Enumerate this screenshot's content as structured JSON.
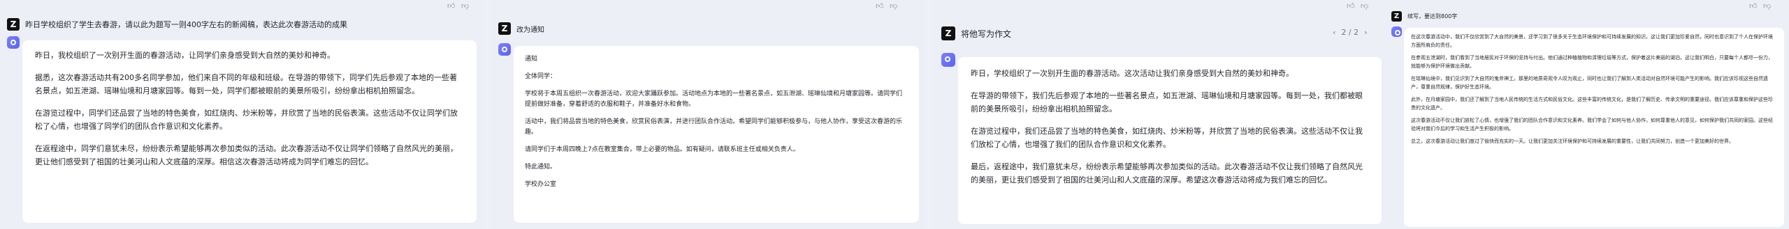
{
  "panels": [
    {
      "question": "昨日学校组织了学生去春游，请以此为题写一则400字左右的新闻稿，表达此次春游活动的成果",
      "paragraphs": [
        "昨日，我校组织了一次别开生面的春游活动，让同学们亲身感受到大自然的美妙和神奇。",
        "据悉，这次春游活动共有200多名同学参加，他们来自不同的年级和班级。在导游的带领下，同学们先后参观了本地的一些著名景点，如五泄湖、瑶琳仙境和月塘家园等。每到一处，同学们都被眼前的美景所吸引，纷纷拿出相机拍照留念。",
        "在游览过程中，同学们还品尝了当地的特色美食，如红烧肉、炒米粉等，并欣赏了当地的民俗表演。这些活动不仅让同学们放松了心情，也增强了同学们的团队合作意识和文化素养。",
        "在返程途中，同学们意犹未尽，纷纷表示希望能够再次参加类似的活动。此次春游活动不仅让同学们领略了自然风光的美丽，更让他们感受到了祖国的壮美河山和人文底蕴的深厚。相信这次春游活动将成为同学们难忘的回忆。"
      ]
    },
    {
      "question": "改为通知",
      "paragraphs": [
        "通知",
        "全体同学：",
        "学校将于本周五组织一次春游活动，欢迎大家踊跃参加。活动地点为本地的一些著名景点，如五泄湖、瑶琳仙境和月塘家园等。请同学们提前做好准备，穿着舒适的衣服和鞋子，并准备好水和食物。",
        "活动中，我们将品尝当地的特色美食，欣赏民俗表演，并进行团队合作活动。希望同学们能够积极参与，与他人协作，享受这次春游的乐趣。",
        "请同学们于本周四晚上7点在教室集合，带上必要的物品。如有疑问，请联系班主任或相关负责人。",
        "特此通知。",
        "学校办公室"
      ]
    },
    {
      "question": "将他写为作文",
      "pager": "2 / 2",
      "paragraphs": [
        "昨日，学校组织了一次别开生面的春游活动。这次活动让我们亲身感受到大自然的美妙和神奇。",
        "在导游的带领下，我们先后参观了本地的一些著名景点，如五泄湖、瑶琳仙境和月塘家园等。每到一处，我们都被眼前的美景所吸引，纷纷拿出相机拍照留念。",
        "在游览过程中，我们还品尝了当地的特色美食，如红烧肉、炒米粉等，并欣赏了当地的民俗表演。这些活动不仅让我们放松了心情，也增强了我们的团队合作意识和文化素养。",
        "最后，返程途中，我们意犹未尽，纷纷表示希望能够再次参加类似的活动。此次春游活动不仅让我们领略了自然风光的美丽，更让我们感受到了祖国的壮美河山和人文底蕴的深厚。希望这次春游活动将成为我们难忘的回忆。"
      ]
    },
    {
      "question": "续写，要达到800字",
      "paragraphs": [
        "在这次春游活动中，我们不仅欣赏到了大自然的美景，还学习到了很多关于生态环境保护和可持续发展的知识。这让我们更加珍爱自然，同时也意识到了个人在保护环境方面所肩负的责任。",
        "在参观五泄湖时，我们看到了当地居民对于环保的坚持与付出。他们通过种植植物和清理垃圾等方式，保护着这片美丽的湖泊。这让我们明白，只要每个人都尽一份力，就能够为保护环境做出贡献。",
        "在瑶琳仙境中，我们见识到了大自然的鬼斧神工。那里的地质奇观令人叹为观止，同时也让我们了解到人类活动对自然环境可能产生的影响。我们应该珍视这些自然遗产，尊重自然规律，保护好生态环境。",
        "此外，在月塘家园中，我们还了解到了当地人民传统的生活方式和民俗文化。这些丰富的传统文化，是我们了解历史、传承文明的重要途径。我们应该尊重和保护这些珍贵的文化遗产。",
        "这次春游活动不仅让我们放松了心情，也增强了我们的团队合作意识和文化素养。我们学会了如何与他人协作，如何尊重他人的意见，如何保护我们共同的家园。这些经验将对我们今后的学习和生活产生积极的影响。",
        "总之，这次春游活动让我们度过了愉快而充实的一天。让我们更加关注环境保护和可持续发展的重要性，让我们共同努力，创造一个更加美好的世界。"
      ]
    }
  ]
}
